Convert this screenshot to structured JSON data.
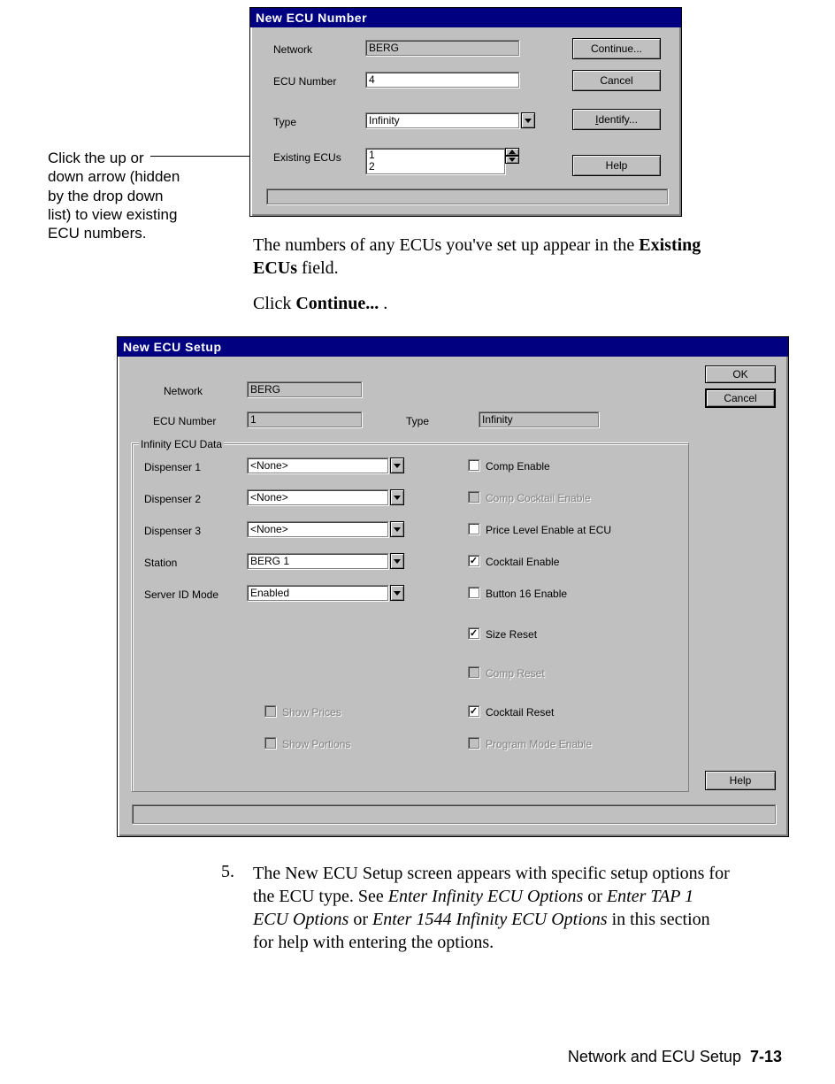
{
  "margin_note": "Click the up or down arrow (hidden by the drop down list) to view existing ECU numbers.",
  "dialog1": {
    "title": "New ECU Number",
    "network_label": "Network",
    "network_value": "BERG",
    "ecunum_label": "ECU Number",
    "ecunum_value": "4",
    "type_label": "Type",
    "type_value": "Infinity",
    "existing_label": "Existing ECUs",
    "existing_line1": "1",
    "existing_line2": "2",
    "btn_continue": "Continue...",
    "btn_cancel": "Cancel",
    "btn_identify_pre": "I",
    "btn_identify_rest": "dentify...",
    "btn_help": "Help"
  },
  "para1_a": "The numbers of any ECUs you've set up appear in the ",
  "para1_bold": "Existing ECUs",
  "para1_b": " field.",
  "para2_a": "Click ",
  "para2_bold": "Continue...",
  "para2_b": " .",
  "dialog2": {
    "title": "New ECU Setup",
    "network_label": "Network",
    "network_value": "BERG",
    "ecunum_label": "ECU Number",
    "ecunum_value": "1",
    "type_label": "Type",
    "type_value": "Infinity",
    "group_label": "Infinity ECU Data",
    "disp1_label": "Dispenser 1",
    "disp1_value": "<None>",
    "disp2_label": "Dispenser 2",
    "disp2_value": "<None>",
    "disp3_label": "Dispenser 3",
    "disp3_value": "<None>",
    "station_label": "Station",
    "station_value": "BERG 1",
    "serverid_label": "Server ID Mode",
    "serverid_value": "Enabled",
    "show_prices": "Show Prices",
    "show_portions": "Show Portions",
    "comp_enable": "Comp Enable",
    "comp_cocktail": "Comp Cocktail Enable",
    "price_level": "Price Level Enable at ECU",
    "cocktail_enable": "Cocktail Enable",
    "button16": "Button 16 Enable",
    "size_reset": "Size Reset",
    "comp_reset": "Comp Reset",
    "cocktail_reset": "Cocktail Reset",
    "program_mode": "Program Mode Enable",
    "btn_ok": "OK",
    "btn_cancel": "Cancel",
    "btn_help": "Help"
  },
  "step5_num": "5.",
  "step5_a": "The New ECU Setup screen appears with specific setup options for the ECU type. See ",
  "step5_i1": "Enter Infinity ECU Options",
  "step5_b": " or ",
  "step5_i2": "Enter TAP 1 ECU Options",
  "step5_c": " or ",
  "step5_i3": "Enter 1544 Infinity ECU Options",
  "step5_d": " in this section for help with entering the options.",
  "footer_text": "Network and ECU Setup",
  "footer_page": "7-13"
}
